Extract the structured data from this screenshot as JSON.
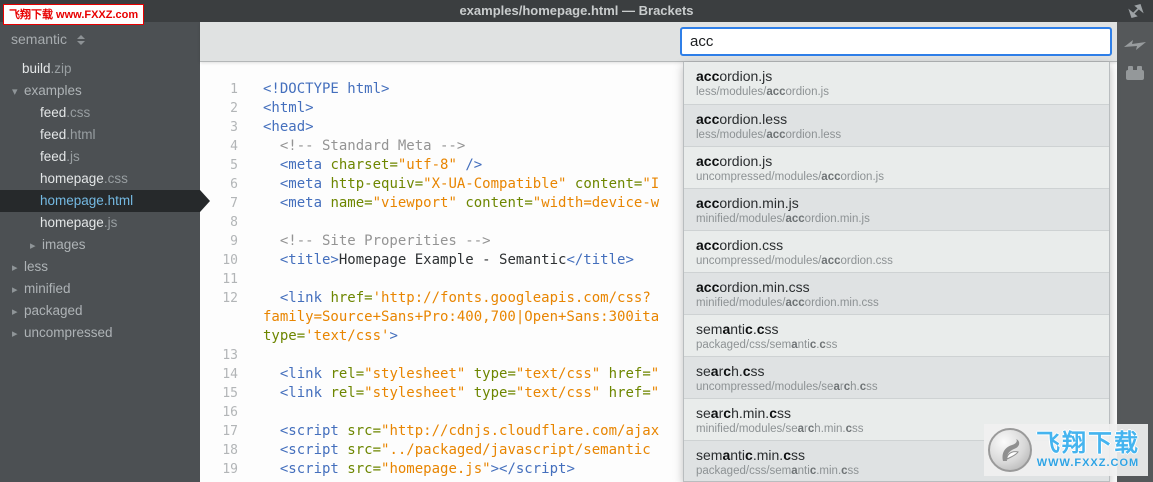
{
  "badge": {
    "text": "飞翔下载 www.FXXZ.com"
  },
  "title_bar": {
    "title": "examples/homepage.html — Brackets"
  },
  "icons": {
    "fullscreen": "expand-arrows-icon",
    "project_switch": "up-down-caret-icon",
    "live_preview": "lightning-bolt-icon",
    "extension_manager": "brick-icon",
    "watermark_logo": "bird-circle-logo"
  },
  "sidebar": {
    "project_name": "semantic",
    "items": [
      {
        "type": "file",
        "name": "build",
        "ext": ".zip",
        "depth": 0,
        "selected": false
      },
      {
        "type": "folder",
        "state": "open",
        "name": "examples",
        "depth": 0
      },
      {
        "type": "file",
        "name": "feed",
        "ext": ".css",
        "depth": 1,
        "selected": false
      },
      {
        "type": "file",
        "name": "feed",
        "ext": ".html",
        "depth": 1,
        "selected": false
      },
      {
        "type": "file",
        "name": "feed",
        "ext": ".js",
        "depth": 1,
        "selected": false
      },
      {
        "type": "file",
        "name": "homepage",
        "ext": ".css",
        "depth": 1,
        "selected": false
      },
      {
        "type": "file",
        "name": "homepage",
        "ext": ".html",
        "depth": 1,
        "selected": true
      },
      {
        "type": "file",
        "name": "homepage",
        "ext": ".js",
        "depth": 1,
        "selected": false
      },
      {
        "type": "folder",
        "state": "closed",
        "name": "images",
        "depth": 1
      },
      {
        "type": "folder",
        "state": "closed",
        "name": "less",
        "depth": 0
      },
      {
        "type": "folder",
        "state": "closed",
        "name": "minified",
        "depth": 0
      },
      {
        "type": "folder",
        "state": "closed",
        "name": "packaged",
        "depth": 0
      },
      {
        "type": "folder",
        "state": "closed",
        "name": "uncompressed",
        "depth": 0
      }
    ]
  },
  "editor": {
    "rows": [
      {
        "num": "1",
        "toks": [
          [
            "<!DOCTYPE html>",
            "t"
          ]
        ]
      },
      {
        "num": "2",
        "toks": [
          [
            "<html>",
            "t"
          ]
        ]
      },
      {
        "num": "3",
        "toks": [
          [
            "<head>",
            "t"
          ]
        ]
      },
      {
        "num": "4",
        "toks": [
          [
            "  ",
            "n"
          ],
          [
            "<!-- Standard Meta -->",
            "c"
          ]
        ]
      },
      {
        "num": "5",
        "toks": [
          [
            "  <meta ",
            "t"
          ],
          [
            "charset=",
            "a"
          ],
          [
            "\"utf-8\"",
            "s"
          ],
          [
            " ",
            "n"
          ],
          [
            "/>",
            "t"
          ]
        ]
      },
      {
        "num": "6",
        "toks": [
          [
            "  <meta ",
            "t"
          ],
          [
            "http-equiv=",
            "a"
          ],
          [
            "\"X-UA-Compatible\"",
            "s"
          ],
          [
            " ",
            "n"
          ],
          [
            "content=",
            "a"
          ],
          [
            "\"I",
            "s"
          ]
        ]
      },
      {
        "num": "7",
        "toks": [
          [
            "  <meta ",
            "t"
          ],
          [
            "name=",
            "a"
          ],
          [
            "\"viewport\"",
            "s"
          ],
          [
            " ",
            "n"
          ],
          [
            "content=",
            "a"
          ],
          [
            "\"width=device-w",
            "s"
          ]
        ]
      },
      {
        "num": "8",
        "toks": []
      },
      {
        "num": "9",
        "toks": [
          [
            "  ",
            "n"
          ],
          [
            "<!-- Site Properities -->",
            "c"
          ]
        ]
      },
      {
        "num": "10",
        "toks": [
          [
            "  ",
            "n"
          ],
          [
            "<title>",
            "t"
          ],
          [
            "Homepage Example - Semantic",
            "n"
          ],
          [
            "</title>",
            "t"
          ]
        ]
      },
      {
        "num": "11",
        "toks": []
      },
      {
        "num": "12",
        "toks": [
          [
            "  <link ",
            "t"
          ],
          [
            "href=",
            "a"
          ],
          [
            "'http://fonts.googleapis.com/css?",
            "s"
          ]
        ]
      },
      {
        "num": "",
        "toks": [
          [
            "family=Source+Sans+Pro:400,700|Open+Sans:300ita",
            "s"
          ]
        ]
      },
      {
        "num": "",
        "toks": [
          [
            "type=",
            "a"
          ],
          [
            "'text/css'",
            "s"
          ],
          [
            ">",
            "t"
          ]
        ]
      },
      {
        "num": "13",
        "toks": []
      },
      {
        "num": "14",
        "toks": [
          [
            "  <link ",
            "t"
          ],
          [
            "rel=",
            "a"
          ],
          [
            "\"stylesheet\"",
            "s"
          ],
          [
            " ",
            "n"
          ],
          [
            "type=",
            "a"
          ],
          [
            "\"text/css\"",
            "s"
          ],
          [
            " ",
            "n"
          ],
          [
            "href=",
            "a"
          ],
          [
            "\"",
            "s"
          ]
        ]
      },
      {
        "num": "15",
        "toks": [
          [
            "  <link ",
            "t"
          ],
          [
            "rel=",
            "a"
          ],
          [
            "\"stylesheet\"",
            "s"
          ],
          [
            " ",
            "n"
          ],
          [
            "type=",
            "a"
          ],
          [
            "\"text/css\"",
            "s"
          ],
          [
            " ",
            "n"
          ],
          [
            "href=",
            "a"
          ],
          [
            "\"",
            "s"
          ]
        ]
      },
      {
        "num": "16",
        "toks": []
      },
      {
        "num": "17",
        "toks": [
          [
            "  <script ",
            "t"
          ],
          [
            "src=",
            "a"
          ],
          [
            "\"http://cdnjs.cloudflare.com/ajax",
            "s"
          ]
        ]
      },
      {
        "num": "18",
        "toks": [
          [
            "  <script ",
            "t"
          ],
          [
            "src=",
            "a"
          ],
          [
            "\"../packaged/javascript/semantic",
            "s"
          ]
        ]
      },
      {
        "num": "19",
        "toks": [
          [
            "  <script ",
            "t"
          ],
          [
            "src=",
            "a"
          ],
          [
            "\"homepage.js\"",
            "s"
          ],
          [
            "></script>",
            "t"
          ]
        ]
      }
    ]
  },
  "quick_open": {
    "query": "acc",
    "results": [
      {
        "name": [
          [
            "acc",
            1
          ],
          [
            "ordion.js",
            0
          ]
        ],
        "path": [
          [
            "less/modules/",
            0
          ],
          [
            "acc",
            1
          ],
          [
            "ordion.js",
            0
          ]
        ]
      },
      {
        "name": [
          [
            "acc",
            1
          ],
          [
            "ordion.less",
            0
          ]
        ],
        "path": [
          [
            "less/modules/",
            0
          ],
          [
            "acc",
            1
          ],
          [
            "ordion.less",
            0
          ]
        ]
      },
      {
        "name": [
          [
            "acc",
            1
          ],
          [
            "ordion.js",
            0
          ]
        ],
        "path": [
          [
            "uncompressed/modules/",
            0
          ],
          [
            "acc",
            1
          ],
          [
            "ordion.js",
            0
          ]
        ]
      },
      {
        "name": [
          [
            "acc",
            1
          ],
          [
            "ordion.min.js",
            0
          ]
        ],
        "path": [
          [
            "minified/modules/",
            0
          ],
          [
            "acc",
            1
          ],
          [
            "ordion.min.js",
            0
          ]
        ]
      },
      {
        "name": [
          [
            "acc",
            1
          ],
          [
            "ordion.css",
            0
          ]
        ],
        "path": [
          [
            "uncompressed/modules/",
            0
          ],
          [
            "acc",
            1
          ],
          [
            "ordion.css",
            0
          ]
        ]
      },
      {
        "name": [
          [
            "acc",
            1
          ],
          [
            "ordion.min.css",
            0
          ]
        ],
        "path": [
          [
            "minified/modules/",
            0
          ],
          [
            "acc",
            1
          ],
          [
            "ordion.min.css",
            0
          ]
        ]
      },
      {
        "name": [
          [
            "sem",
            0
          ],
          [
            "a",
            1
          ],
          [
            "nti",
            0
          ],
          [
            "c",
            1
          ],
          [
            ".",
            0
          ],
          [
            "c",
            1
          ],
          [
            "ss",
            0
          ]
        ],
        "path": [
          [
            "packaged/css/sem",
            0
          ],
          [
            "a",
            1
          ],
          [
            "nti",
            0
          ],
          [
            "c",
            1
          ],
          [
            ".",
            0
          ],
          [
            "c",
            1
          ],
          [
            "ss",
            0
          ]
        ]
      },
      {
        "name": [
          [
            "se",
            0
          ],
          [
            "a",
            1
          ],
          [
            "r",
            0
          ],
          [
            "c",
            1
          ],
          [
            "h.",
            0
          ],
          [
            "c",
            1
          ],
          [
            "ss",
            0
          ]
        ],
        "path": [
          [
            "uncompressed/modules/se",
            0
          ],
          [
            "a",
            1
          ],
          [
            "r",
            0
          ],
          [
            "c",
            1
          ],
          [
            "h.",
            0
          ],
          [
            "c",
            1
          ],
          [
            "ss",
            0
          ]
        ]
      },
      {
        "name": [
          [
            "se",
            0
          ],
          [
            "a",
            1
          ],
          [
            "r",
            0
          ],
          [
            "c",
            1
          ],
          [
            "h.min.",
            0
          ],
          [
            "c",
            1
          ],
          [
            "ss",
            0
          ]
        ],
        "path": [
          [
            "minified/modules/se",
            0
          ],
          [
            "a",
            1
          ],
          [
            "r",
            0
          ],
          [
            "c",
            1
          ],
          [
            "h.min.",
            0
          ],
          [
            "c",
            1
          ],
          [
            "ss",
            0
          ]
        ]
      },
      {
        "name": [
          [
            "sem",
            0
          ],
          [
            "a",
            1
          ],
          [
            "nti",
            0
          ],
          [
            "c",
            1
          ],
          [
            ".min.",
            0
          ],
          [
            "c",
            1
          ],
          [
            "ss",
            0
          ]
        ],
        "path": [
          [
            "packaged/css/sem",
            0
          ],
          [
            "a",
            1
          ],
          [
            "nti",
            0
          ],
          [
            "c",
            1
          ],
          [
            ".min.",
            0
          ],
          [
            "c",
            1
          ],
          [
            "ss",
            0
          ]
        ]
      }
    ]
  },
  "watermark": {
    "line1": "飞翔下载",
    "line2": "WWW.FXXZ.COM"
  }
}
